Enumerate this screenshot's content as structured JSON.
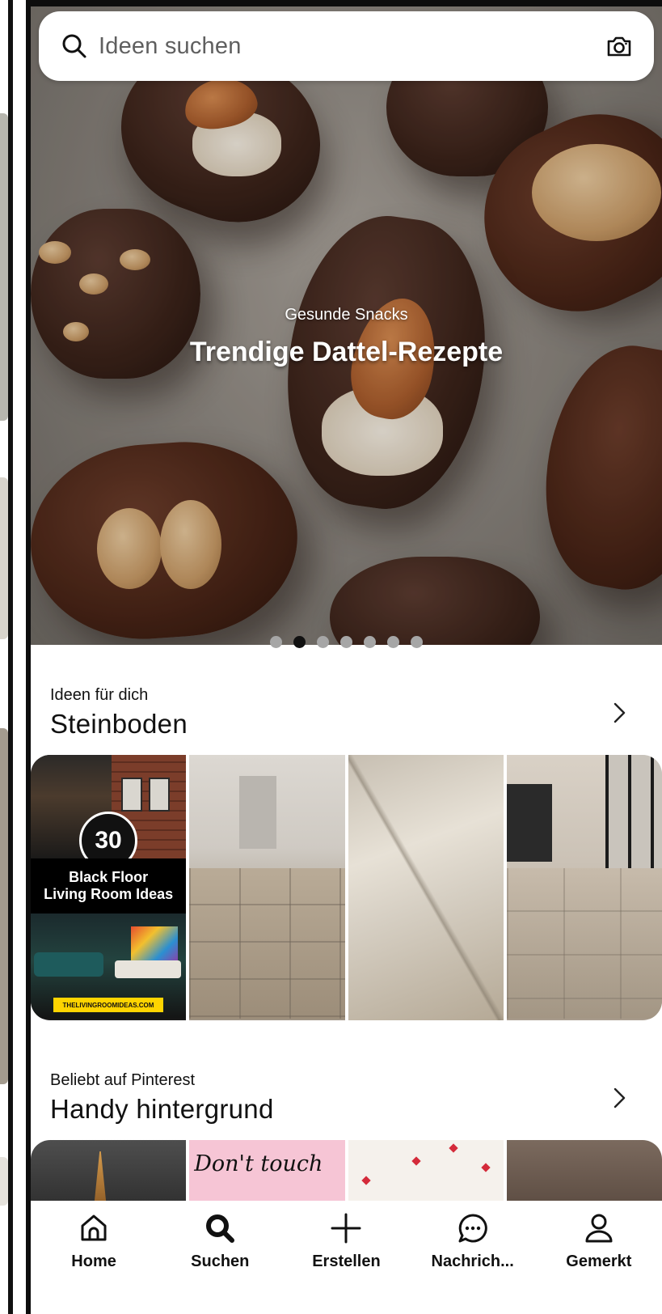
{
  "search": {
    "placeholder": "Ideen suchen"
  },
  "hero": {
    "subtitle": "Gesunde Snacks",
    "title": "Trendige Dattel-Rezepte",
    "dot_count": 7,
    "active_dot": 1
  },
  "sections": [
    {
      "subtitle": "Ideen für dich",
      "title": "Steinboden",
      "tiles": [
        {
          "badge": "30",
          "label_line1": "Black Floor",
          "label_line2": "Living Room Ideas",
          "source": "THELIVINGROOMIDEAS.COM"
        },
        {},
        {},
        {}
      ]
    },
    {
      "subtitle": "Beliebt auf Pinterest",
      "title": "Handy hintergrund",
      "tiles": [
        {},
        {
          "text": "Don't touch"
        },
        {},
        {}
      ]
    }
  ],
  "nav": [
    {
      "label": "Home",
      "icon": "home-icon"
    },
    {
      "label": "Suchen",
      "icon": "search-icon",
      "active": true
    },
    {
      "label": "Erstellen",
      "icon": "plus-icon"
    },
    {
      "label": "Nachrich...",
      "icon": "message-icon"
    },
    {
      "label": "Gemerkt",
      "icon": "profile-icon"
    }
  ],
  "colors": {
    "active_dot": "#111111",
    "inactive_dot": "#a6a6a6",
    "text": "#111111"
  }
}
